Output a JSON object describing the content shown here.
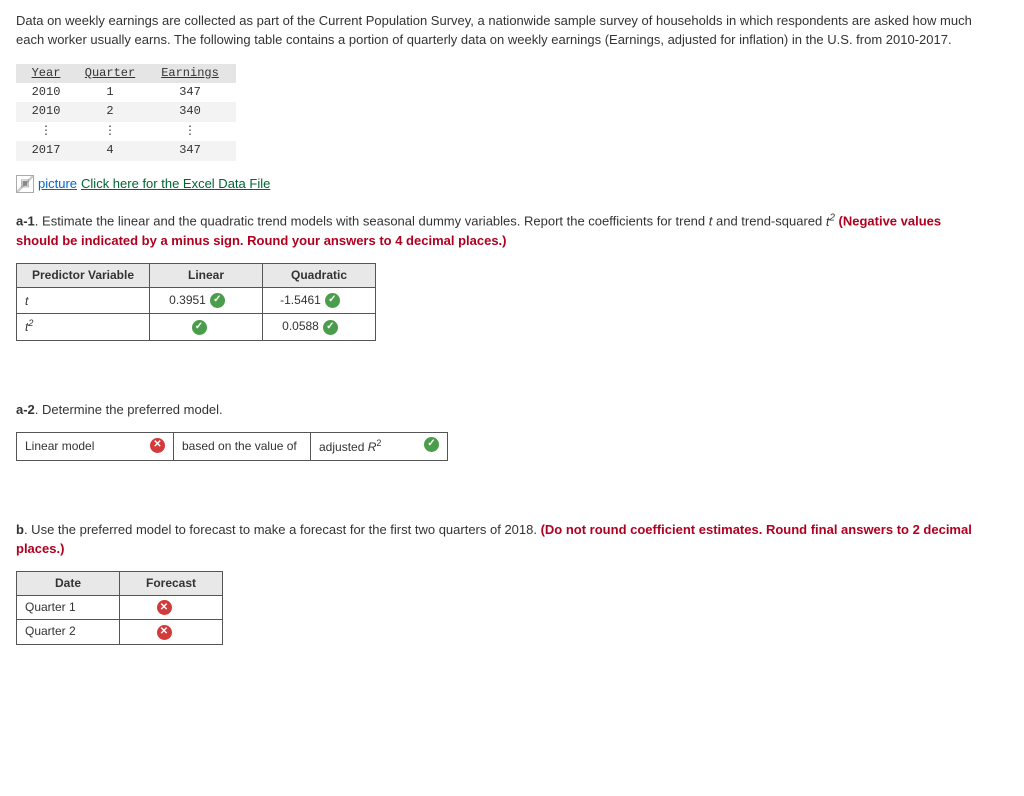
{
  "intro": "Data on weekly earnings are collected as part of the Current Population Survey, a nationwide sample survey of households in which respondents are asked how much each worker usually earns. The following table contains a portion of quarterly data on weekly earnings (Earnings, adjusted for inflation) in the U.S. from 2010-2017.",
  "data_table": {
    "headers": [
      "Year",
      "Quarter",
      "Earnings"
    ],
    "rows": [
      {
        "year": "2010",
        "quarter": "1",
        "earnings": "347"
      },
      {
        "year": "2010",
        "quarter": "2",
        "earnings": "340"
      },
      {
        "year": "⋮",
        "quarter": "⋮",
        "earnings": "⋮"
      },
      {
        "year": "2017",
        "quarter": "4",
        "earnings": "347"
      }
    ]
  },
  "excel": {
    "alt": "picture",
    "link": "Click here for the Excel Data File"
  },
  "a1": {
    "prefix": "a-1",
    "text1": ". Estimate the linear and the quadratic trend models with seasonal dummy variables. Report the coefficients for trend ",
    "tvar": "t",
    "text2": " and trend-squared ",
    "t2var": "t",
    "t2sup": "2",
    "hint": " (Negative values should be indicated by a minus sign. Round your answers to 4 decimal places.)",
    "table": {
      "headers": [
        "Predictor Variable",
        "Linear",
        "Quadratic"
      ],
      "rows": [
        {
          "label_base": "t",
          "label_sup": "",
          "linear": "0.3951",
          "linear_ok": true,
          "quad": "-1.5461",
          "quad_ok": true
        },
        {
          "label_base": "t",
          "label_sup": "2",
          "linear": "",
          "linear_ok": true,
          "quad": "0.0588",
          "quad_ok": true
        }
      ]
    }
  },
  "a2": {
    "prefix": "a-2",
    "text": ". Determine the preferred model.",
    "cells": {
      "model": "Linear model",
      "model_ok": false,
      "mid": "based on the value of",
      "metric_base": "adjusted ",
      "metric_var": "R",
      "metric_sup": "2",
      "metric_ok": true
    }
  },
  "b": {
    "prefix": "b",
    "text": ". Use the preferred model to forecast to make a forecast for the first two quarters of 2018. ",
    "hint": "(Do not round coefficient estimates. Round final answers to 2 decimal places.)",
    "table": {
      "headers": [
        "Date",
        "Forecast"
      ],
      "rows": [
        {
          "label": "Quarter 1",
          "val": "",
          "ok": false
        },
        {
          "label": "Quarter 2",
          "val": "",
          "ok": false
        }
      ]
    }
  }
}
